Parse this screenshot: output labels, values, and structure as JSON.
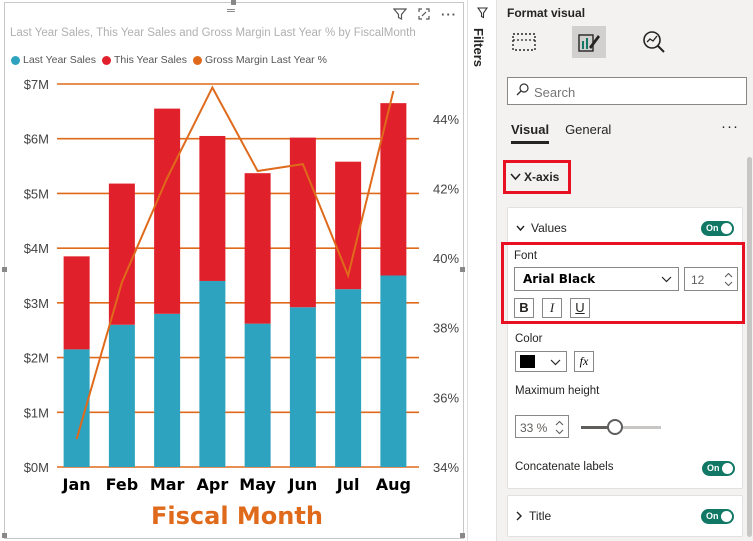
{
  "chart": {
    "title": "Last Year Sales, This Year Sales and Gross Margin Last Year % by FiscalMonth",
    "legend": [
      {
        "label": "Last Year Sales",
        "color": "#2ea3bf"
      },
      {
        "label": "This Year Sales",
        "color": "#e0202a"
      },
      {
        "label": "Gross Margin Last Year %",
        "color": "#e06a1b"
      }
    ],
    "x_title": "Fiscal Month",
    "x_title_color": "#e06a1b",
    "toolbar_icons": [
      "filter-icon",
      "focus-mode-icon",
      "more-options-icon"
    ]
  },
  "chart_data": {
    "type": "bar",
    "stacked": true,
    "categories": [
      "Jan",
      "Feb",
      "Mar",
      "Apr",
      "May",
      "Jun",
      "Jul",
      "Aug"
    ],
    "series": [
      {
        "name": "Last Year Sales",
        "color": "#2ea3bf",
        "values": [
          2.15,
          2.6,
          2.8,
          3.4,
          2.62,
          2.92,
          3.25,
          3.5
        ]
      },
      {
        "name": "This Year Sales",
        "color": "#e0202a",
        "values": [
          1.7,
          2.58,
          3.75,
          2.65,
          2.75,
          3.1,
          2.33,
          3.15
        ]
      },
      {
        "name": "Gross Margin Last Year %",
        "color": "#e06a1b",
        "type": "line",
        "axis": "right",
        "values": [
          34.8,
          39.3,
          42.3,
          44.9,
          42.5,
          42.7,
          39.5,
          44.8
        ]
      }
    ],
    "y_ticks": [
      "$0M",
      "$1M",
      "$2M",
      "$3M",
      "$4M",
      "$5M",
      "$6M",
      "$7M"
    ],
    "ylim": [
      0,
      7
    ],
    "y2_ticks": [
      "34%",
      "36%",
      "38%",
      "40%",
      "42%",
      "44%"
    ],
    "y2lim": [
      34,
      45
    ],
    "gridline_color": "#e06a1b",
    "grid": true,
    "legend_position": "top-left"
  },
  "filters": {
    "label": "Filters"
  },
  "format_pane": {
    "title": "Format visual",
    "icons": [
      "build-visual-icon",
      "format-visual-icon",
      "analytics-icon"
    ],
    "search_placeholder": "Search",
    "tabs": [
      "Visual",
      "General"
    ],
    "more": "···",
    "section": "X-axis",
    "values_card": {
      "header": "Values",
      "toggle": "On",
      "font_label": "Font",
      "font_family": "Arial Black",
      "font_size": "12",
      "bold": "B",
      "italic": "I",
      "underline": "U",
      "color_label": "Color",
      "color_value": "#000000",
      "fx": "fx",
      "max_height_label": "Maximum height",
      "max_height_value": "33 %",
      "max_height_level": 0.33,
      "concatenate_label": "Concatenate labels",
      "concatenate_toggle": "On"
    },
    "title_card": {
      "header": "Title",
      "toggle": "On"
    }
  }
}
